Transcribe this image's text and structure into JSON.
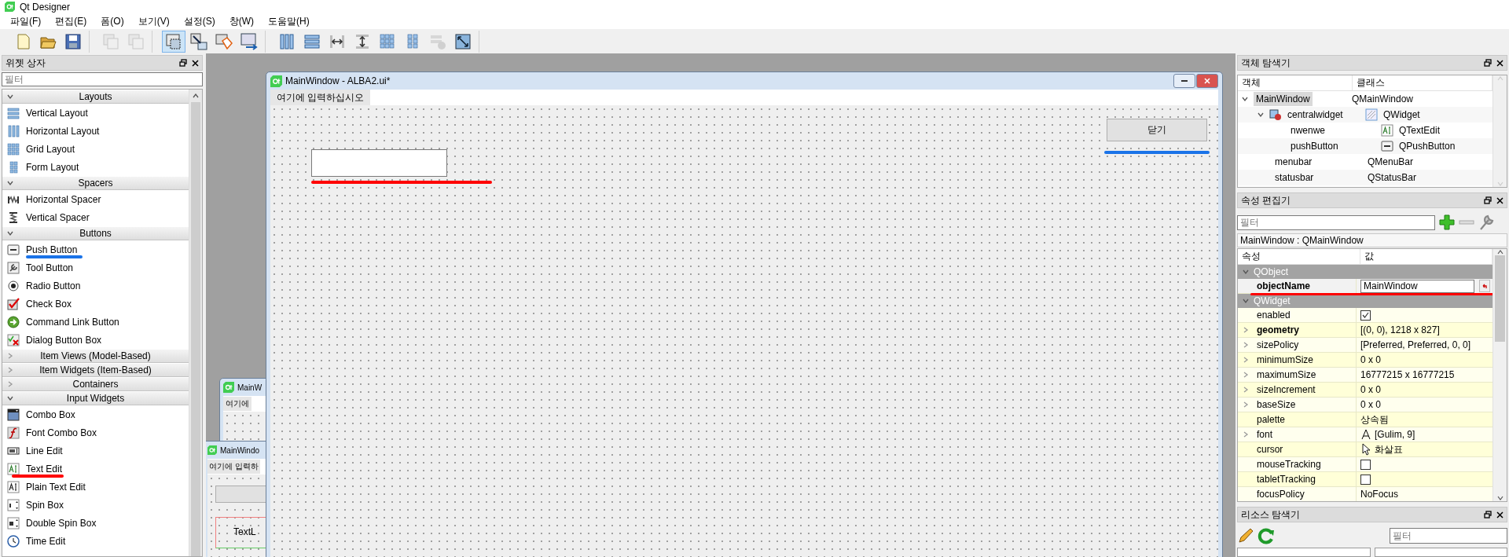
{
  "app_title": "Qt Designer",
  "menu": [
    "파일(F)",
    "편집(E)",
    "폼(O)",
    "보기(V)",
    "설정(S)",
    "창(W)",
    "도움말(H)"
  ],
  "toolbar": [
    [
      {
        "kind": "new",
        "selected": false,
        "disabled": false
      },
      {
        "kind": "open",
        "selected": false,
        "disabled": false
      },
      {
        "kind": "save",
        "selected": false,
        "disabled": false
      }
    ],
    [
      {
        "kind": "raise",
        "selected": false,
        "disabled": true
      },
      {
        "kind": "lower",
        "selected": false,
        "disabled": true
      }
    ],
    [
      {
        "kind": "edit-widgets",
        "selected": true,
        "disabled": false
      },
      {
        "kind": "signals",
        "selected": false,
        "disabled": false
      },
      {
        "kind": "buddies",
        "selected": false,
        "disabled": false
      },
      {
        "kind": "tab-order",
        "selected": false,
        "disabled": false
      }
    ],
    [
      {
        "kind": "hlayout",
        "selected": false,
        "disabled": false
      },
      {
        "kind": "vlayout",
        "selected": false,
        "disabled": false
      },
      {
        "kind": "hsplit",
        "selected": false,
        "disabled": false
      },
      {
        "kind": "vsplit",
        "selected": false,
        "disabled": false
      },
      {
        "kind": "grid",
        "selected": false,
        "disabled": false
      },
      {
        "kind": "form",
        "selected": false,
        "disabled": false
      },
      {
        "kind": "break",
        "selected": false,
        "disabled": true
      },
      {
        "kind": "adjust",
        "selected": false,
        "disabled": false
      }
    ]
  ],
  "widget_box": {
    "title": "위젯 상자",
    "filter_placeholder": "필터",
    "groups": [
      {
        "name": "Layouts",
        "expanded": true,
        "items": [
          {
            "label": "Vertical Layout",
            "kind": "vlayout"
          },
          {
            "label": "Horizontal Layout",
            "kind": "hlayout"
          },
          {
            "label": "Grid Layout",
            "kind": "grid"
          },
          {
            "label": "Form Layout",
            "kind": "form"
          }
        ]
      },
      {
        "name": "Spacers",
        "expanded": true,
        "items": [
          {
            "label": "Horizontal Spacer",
            "kind": "hspacer"
          },
          {
            "label": "Vertical Spacer",
            "kind": "vspacer"
          }
        ]
      },
      {
        "name": "Buttons",
        "expanded": true,
        "items": [
          {
            "label": "Push Button",
            "kind": "ok",
            "color": "#1a73e8"
          },
          {
            "label": "Tool Button",
            "kind": "tool"
          },
          {
            "label": "Radio Button",
            "kind": "radio"
          },
          {
            "label": "Check Box",
            "kind": "check"
          },
          {
            "label": "Command Link Button",
            "kind": "command"
          },
          {
            "label": "Dialog Button Box",
            "kind": "dialog"
          }
        ]
      },
      {
        "name": "Item Views (Model-Based)",
        "expanded": false
      },
      {
        "name": "Item Widgets (Item-Based)",
        "expanded": false
      },
      {
        "name": "Containers",
        "expanded": false
      },
      {
        "name": "Input Widgets",
        "expanded": true,
        "items": [
          {
            "label": "Combo Box",
            "kind": "combo"
          },
          {
            "label": "Font Combo Box",
            "kind": "font"
          },
          {
            "label": "Line Edit",
            "kind": "lineedit"
          },
          {
            "label": "Text Edit",
            "kind": "textedit",
            "color": "#ff0000"
          },
          {
            "label": "Plain Text Edit",
            "kind": "plaintext"
          },
          {
            "label": "Spin Box",
            "kind": "spin"
          },
          {
            "label": "Double Spin Box",
            "kind": "dspin"
          },
          {
            "label": "Time Edit",
            "kind": "time"
          }
        ]
      }
    ]
  },
  "back_windows": [
    {
      "title": "MainW",
      "menu_placeholder": "여기에"
    },
    {
      "title": "MainWindo",
      "menu_placeholder": "여기에 입력하",
      "label": "TextL"
    }
  ],
  "form_window": {
    "title": "MainWindow - ALBA2.ui*",
    "menu_placeholder": "여기에 입력하십시오",
    "text_edit": {
      "color": "#ff0000"
    },
    "button": {
      "label": "닫기",
      "color": "#1a73e8"
    }
  },
  "object_inspector": {
    "title": "객체 탐색기",
    "columns": [
      "객체",
      "클래스"
    ],
    "rows": [
      {
        "object": "MainWindow",
        "class": "QMainWindow",
        "selected": true,
        "expanded": true,
        "children": [
          {
            "object": "centralwidget",
            "class": "QWidget",
            "kind": "container",
            "selected": false,
            "expanded": true,
            "children": [
              {
                "object": "nwenwe",
                "class": "QTextEdit",
                "kind": "textedit",
                "selected": false
              },
              {
                "object": "pushButton",
                "class": "QPushButton",
                "kind": "button",
                "selected": false
              }
            ]
          },
          {
            "object": "menubar",
            "class": "QMenuBar",
            "selected": false
          },
          {
            "object": "statusbar",
            "class": "QStatusBar",
            "selected": false
          }
        ]
      }
    ]
  },
  "property_editor": {
    "title": "속성 편집기",
    "filter_placeholder": "필터",
    "object_label": "MainWindow : QMainWindow",
    "columns": [
      "속성",
      "값"
    ],
    "rows": [
      {
        "kind": "group",
        "name": "QObject"
      },
      {
        "kind": "field",
        "name": "objectName",
        "value": "MainWindow",
        "changed": true,
        "expandable": false,
        "color": "#ff0000"
      },
      {
        "kind": "group",
        "name": "QWidget"
      },
      {
        "kind": "check",
        "name": "enabled",
        "checked": true,
        "changed": false,
        "expandable": false
      },
      {
        "kind": "text",
        "name": "geometry",
        "value": "[(0, 0), 1218 x 827]",
        "changed": true,
        "expandable": true
      },
      {
        "kind": "text",
        "name": "sizePolicy",
        "value": "[Preferred, Preferred, 0, 0]",
        "changed": false,
        "expandable": true
      },
      {
        "kind": "text",
        "name": "minimumSize",
        "value": "0 x 0",
        "changed": false,
        "expandable": true
      },
      {
        "kind": "text",
        "name": "maximumSize",
        "value": "16777215 x 16777215",
        "changed": false,
        "expandable": true
      },
      {
        "kind": "text",
        "name": "sizeIncrement",
        "value": "0 x 0",
        "changed": false,
        "expandable": true
      },
      {
        "kind": "text",
        "name": "baseSize",
        "value": "0 x 0",
        "changed": false,
        "expandable": true
      },
      {
        "kind": "text",
        "name": "palette",
        "value": "상속됨",
        "changed": false,
        "expandable": false
      },
      {
        "kind": "font",
        "name": "font",
        "value": "[Gulim, 9]",
        "changed": false,
        "expandable": true
      },
      {
        "kind": "cursor",
        "name": "cursor",
        "value": "화살표",
        "changed": false,
        "expandable": false
      },
      {
        "kind": "check",
        "name": "mouseTracking",
        "checked": false,
        "changed": false,
        "expandable": false
      },
      {
        "kind": "check",
        "name": "tabletTracking",
        "checked": false,
        "changed": false,
        "expandable": false
      },
      {
        "kind": "text",
        "name": "focusPolicy",
        "value": "NoFocus",
        "changed": false,
        "expandable": false
      }
    ]
  },
  "resource_browser": {
    "title": "리소스 탐색기",
    "filter_placeholder": "필터"
  }
}
